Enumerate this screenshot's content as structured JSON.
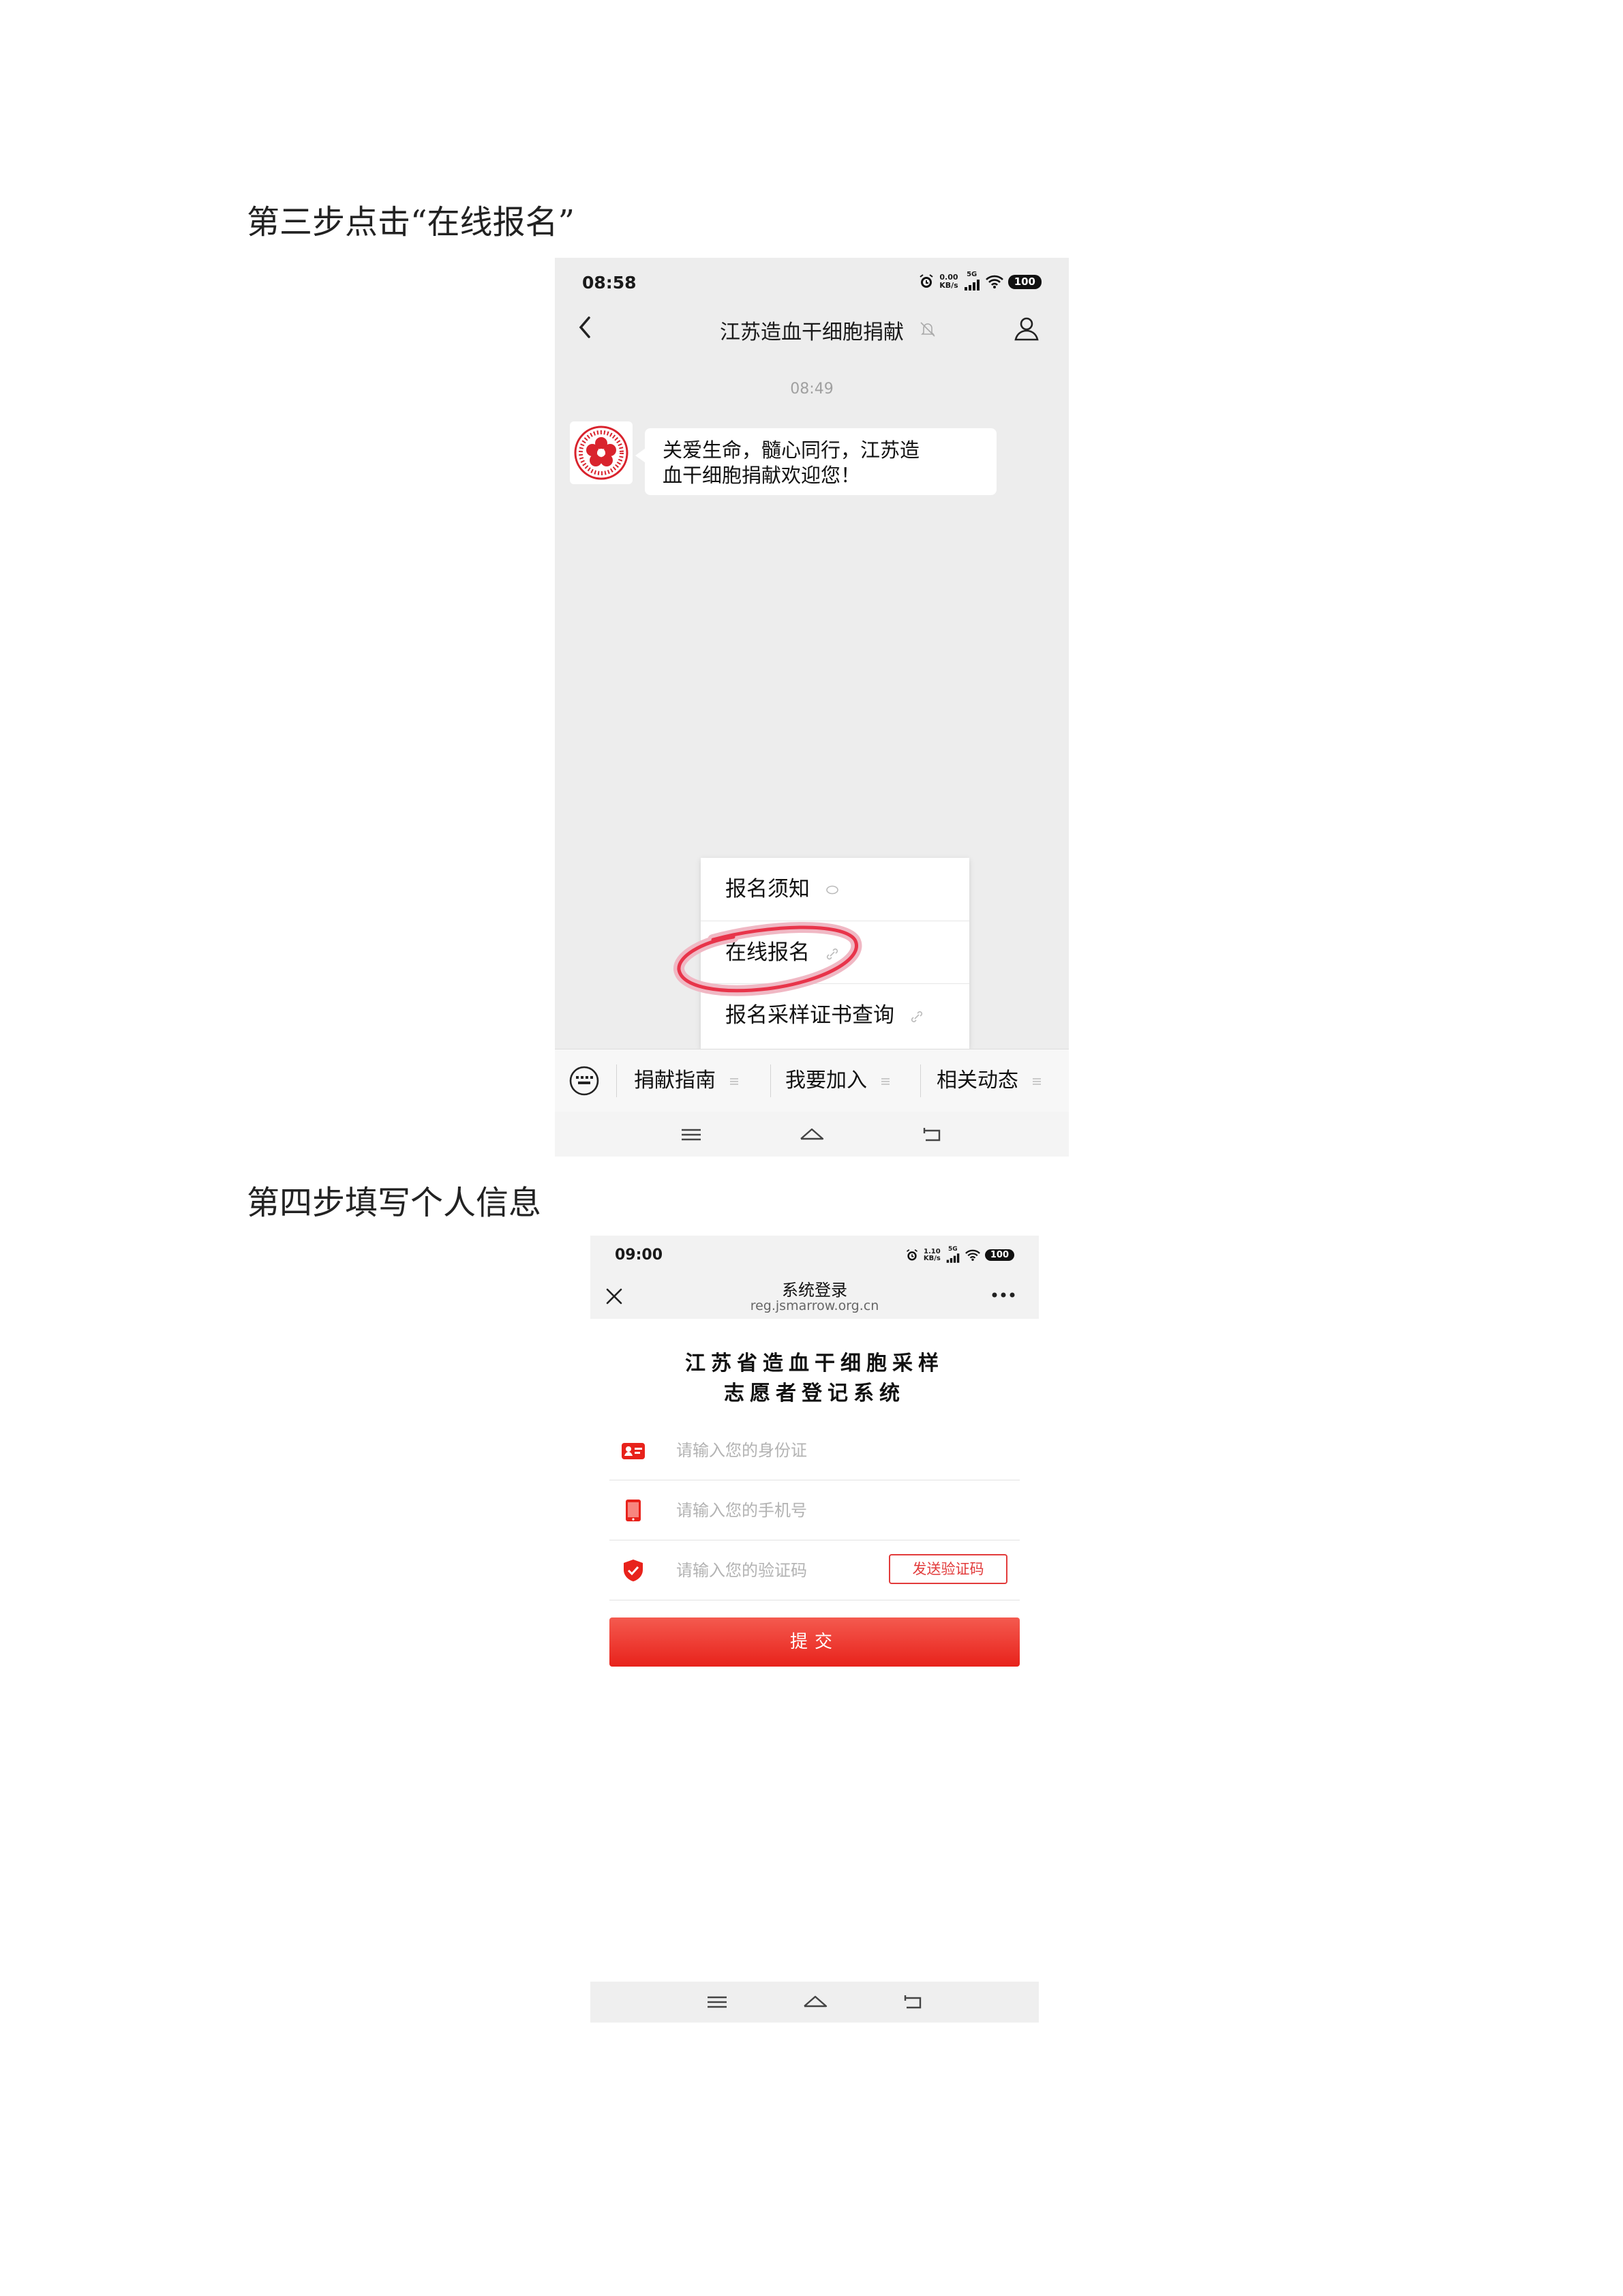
{
  "step3": {
    "heading": "第三步点击“在线报名”"
  },
  "step4": {
    "heading": "第四步填写个人信息"
  },
  "phone1": {
    "status": {
      "time": "08:58",
      "net_speed_value": "0.00",
      "net_speed_unit": "KB/s",
      "network": "5G",
      "battery": "100"
    },
    "header": {
      "title": "江苏造血干细胞捐献"
    },
    "message": {
      "time": "08:49",
      "line1": "关爱生命，髓心同行，江苏造",
      "line2": "血干细胞捐献欢迎您！"
    },
    "popup_menu": {
      "items": [
        {
          "label": "报名须知"
        },
        {
          "label": "在线报名"
        },
        {
          "label": "报名采样证书查询"
        }
      ]
    },
    "menu_bar": {
      "items": [
        {
          "label": "捐献指南"
        },
        {
          "label": "我要加入"
        },
        {
          "label": "相关动态"
        }
      ]
    },
    "highlight_color": "#e8344a",
    "icons": [
      "chevron-left-icon",
      "mute-bell-icon",
      "person-icon",
      "keyboard-icon",
      "menu-icon",
      "home-icon",
      "back-icon"
    ]
  },
  "phone2": {
    "status": {
      "time": "09:00",
      "net_speed_value": "1.10",
      "net_speed_unit": "KB/s",
      "network": "5G",
      "battery": "100"
    },
    "header": {
      "title": "系统登录",
      "url": "reg.jsmarrow.org.cn"
    },
    "system_title": {
      "line1": "江苏省造血干细胞采样",
      "line2": "志愿者登记系统"
    },
    "form": {
      "id_placeholder": "请输入您的身份证",
      "phone_placeholder": "请输入您的手机号",
      "code_placeholder": "请输入您的验证码",
      "send_code_label": "发送验证码",
      "submit_label": "提交"
    },
    "accent_color": "#e8221b"
  }
}
